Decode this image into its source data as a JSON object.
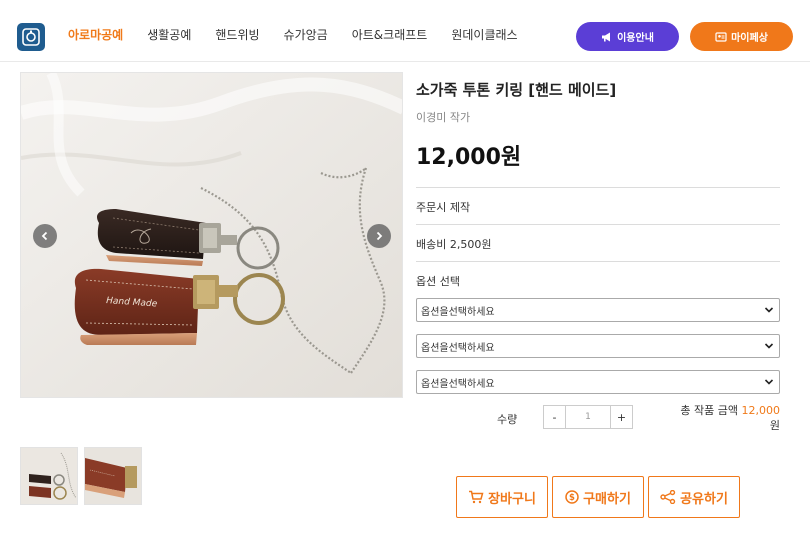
{
  "header": {
    "nav": [
      "아로마공예",
      "생활공예",
      "핸드위빙",
      "슈가앙금",
      "아트&크래프트",
      "원데이클래스"
    ],
    "guide_label": "이용안내",
    "mypage_label": "마이페상"
  },
  "product": {
    "title": "소가죽 투톤 키링 [핸드 메이드]",
    "artist": "이경미 작가",
    "price": "12,000원",
    "made_to_order": "주문시 제작",
    "shipping": "배송비 2,500원",
    "option_heading": "옵션 선택",
    "option_placeholders": [
      "옵션을선택하세요",
      "옵션을선택하세요",
      "옵션을선택하세요"
    ],
    "image_text": "Hand Made"
  },
  "quantity": {
    "label": "수량",
    "minus": "-",
    "value": "1",
    "plus": "+"
  },
  "total": {
    "label": "총 작품 금액",
    "amount": "12,000",
    "unit": "원"
  },
  "actions": {
    "cart": "장바구니",
    "buy": "구매하기",
    "share": "공유하기"
  },
  "colors": {
    "accent_orange": "#f0781a",
    "accent_purple": "#5b3ed6",
    "logo_blue": "#1f5c8f"
  }
}
